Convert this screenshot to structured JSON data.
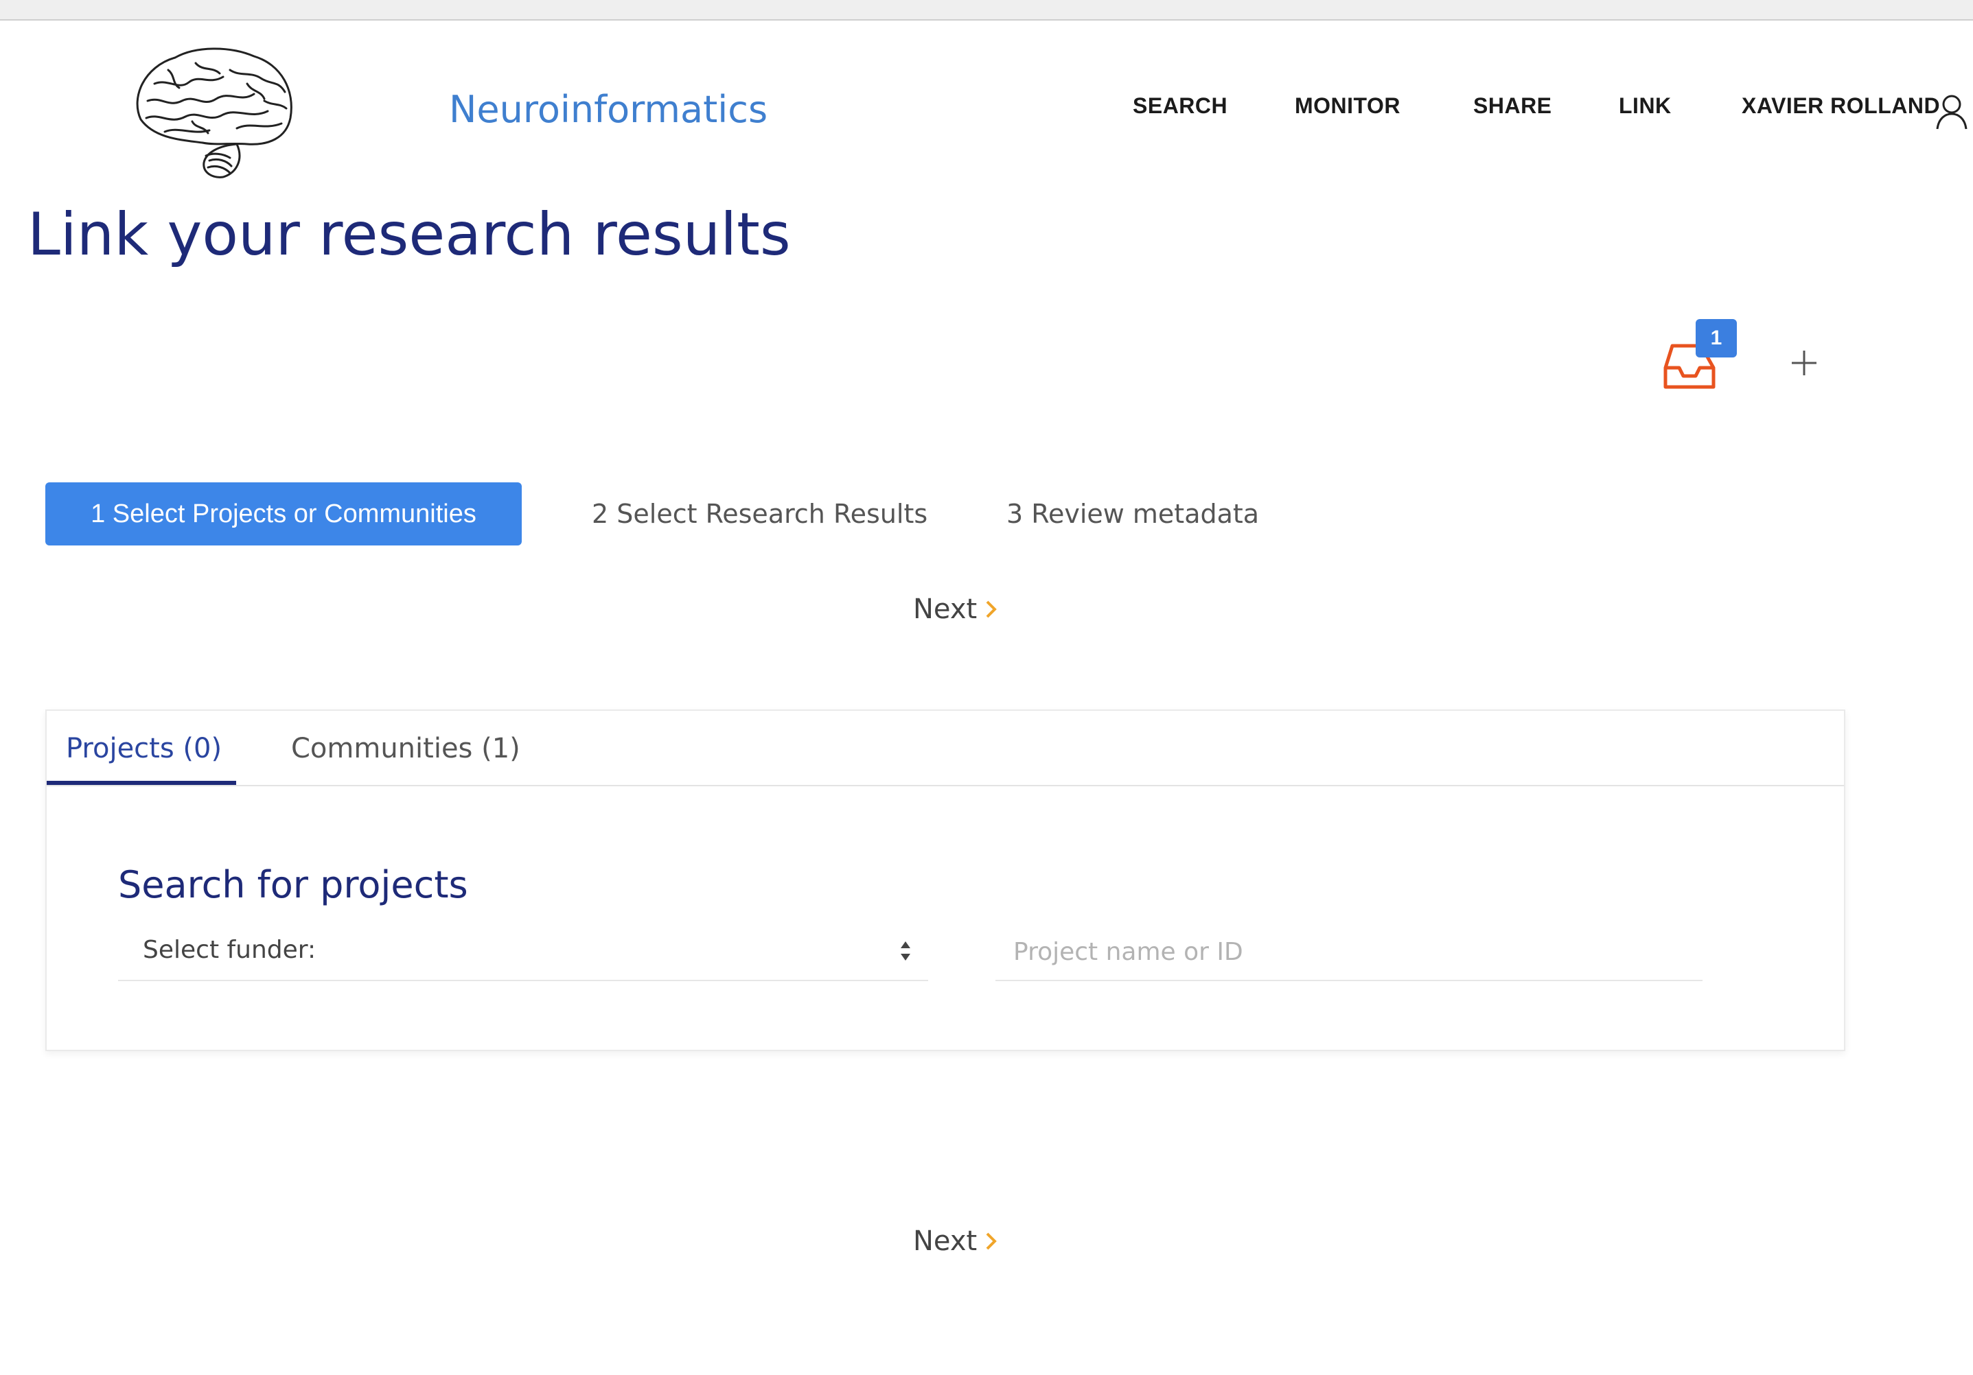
{
  "header": {
    "brand": "Neuroinformatics",
    "nav": [
      {
        "label": "SEARCH"
      },
      {
        "label": "MONITOR"
      },
      {
        "label": "SHARE"
      },
      {
        "label": "LINK"
      },
      {
        "label": "XAVIER ROLLAND"
      }
    ]
  },
  "page": {
    "title": "Link your research results"
  },
  "basket": {
    "count": "1"
  },
  "stepper": {
    "steps": [
      {
        "label": "1 Select Projects or Communities"
      },
      {
        "label": "2 Select Research Results"
      },
      {
        "label": "3 Review metadata"
      }
    ],
    "next_label": "Next"
  },
  "card": {
    "tabs": [
      {
        "label": "Projects (0)"
      },
      {
        "label": "Communities (1)"
      }
    ],
    "search_title": "Search for projects",
    "funder_select": {
      "value": "Select funder:"
    },
    "project_input": {
      "placeholder": "Project name or ID",
      "value": ""
    }
  },
  "colors": {
    "accent": "#3d86e8",
    "title": "#1e2a78",
    "brand": "#3f7fcf",
    "basket": "#e8531f",
    "chevron": "#f0a52a"
  }
}
